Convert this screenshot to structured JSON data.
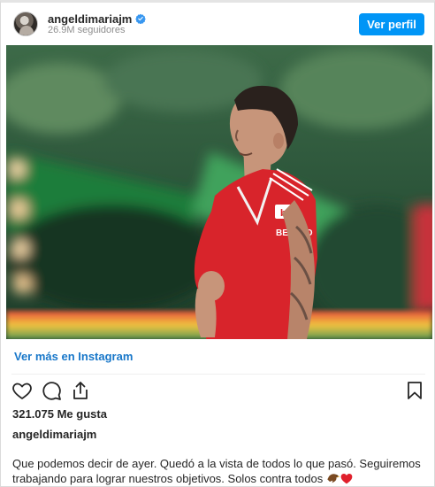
{
  "header": {
    "username": "angeldimariajm",
    "followers": "26.9M seguidores",
    "profile_button": "Ver perfil"
  },
  "post": {
    "image_jersey_text": "BETANO",
    "see_more_link": "Ver más en Instagram",
    "likes": "321.075 Me gusta",
    "caption_username": "angeldimariajm",
    "caption_text": "Que podemos decir de ayer. Quedó a la vista de todos lo que pasó. Seguiremos trabajando para lograr nuestros objetivos. Solos contra todos"
  },
  "colors": {
    "primary_button": "#0095f6",
    "link": "#1877c9",
    "jersey_red": "#d8242b",
    "verified_blue": "#3897f0"
  },
  "icons": [
    "verified-badge-icon",
    "heart-icon",
    "comment-icon",
    "share-icon",
    "bookmark-icon",
    "eagle-emoji-icon",
    "red-heart-emoji-icon"
  ]
}
